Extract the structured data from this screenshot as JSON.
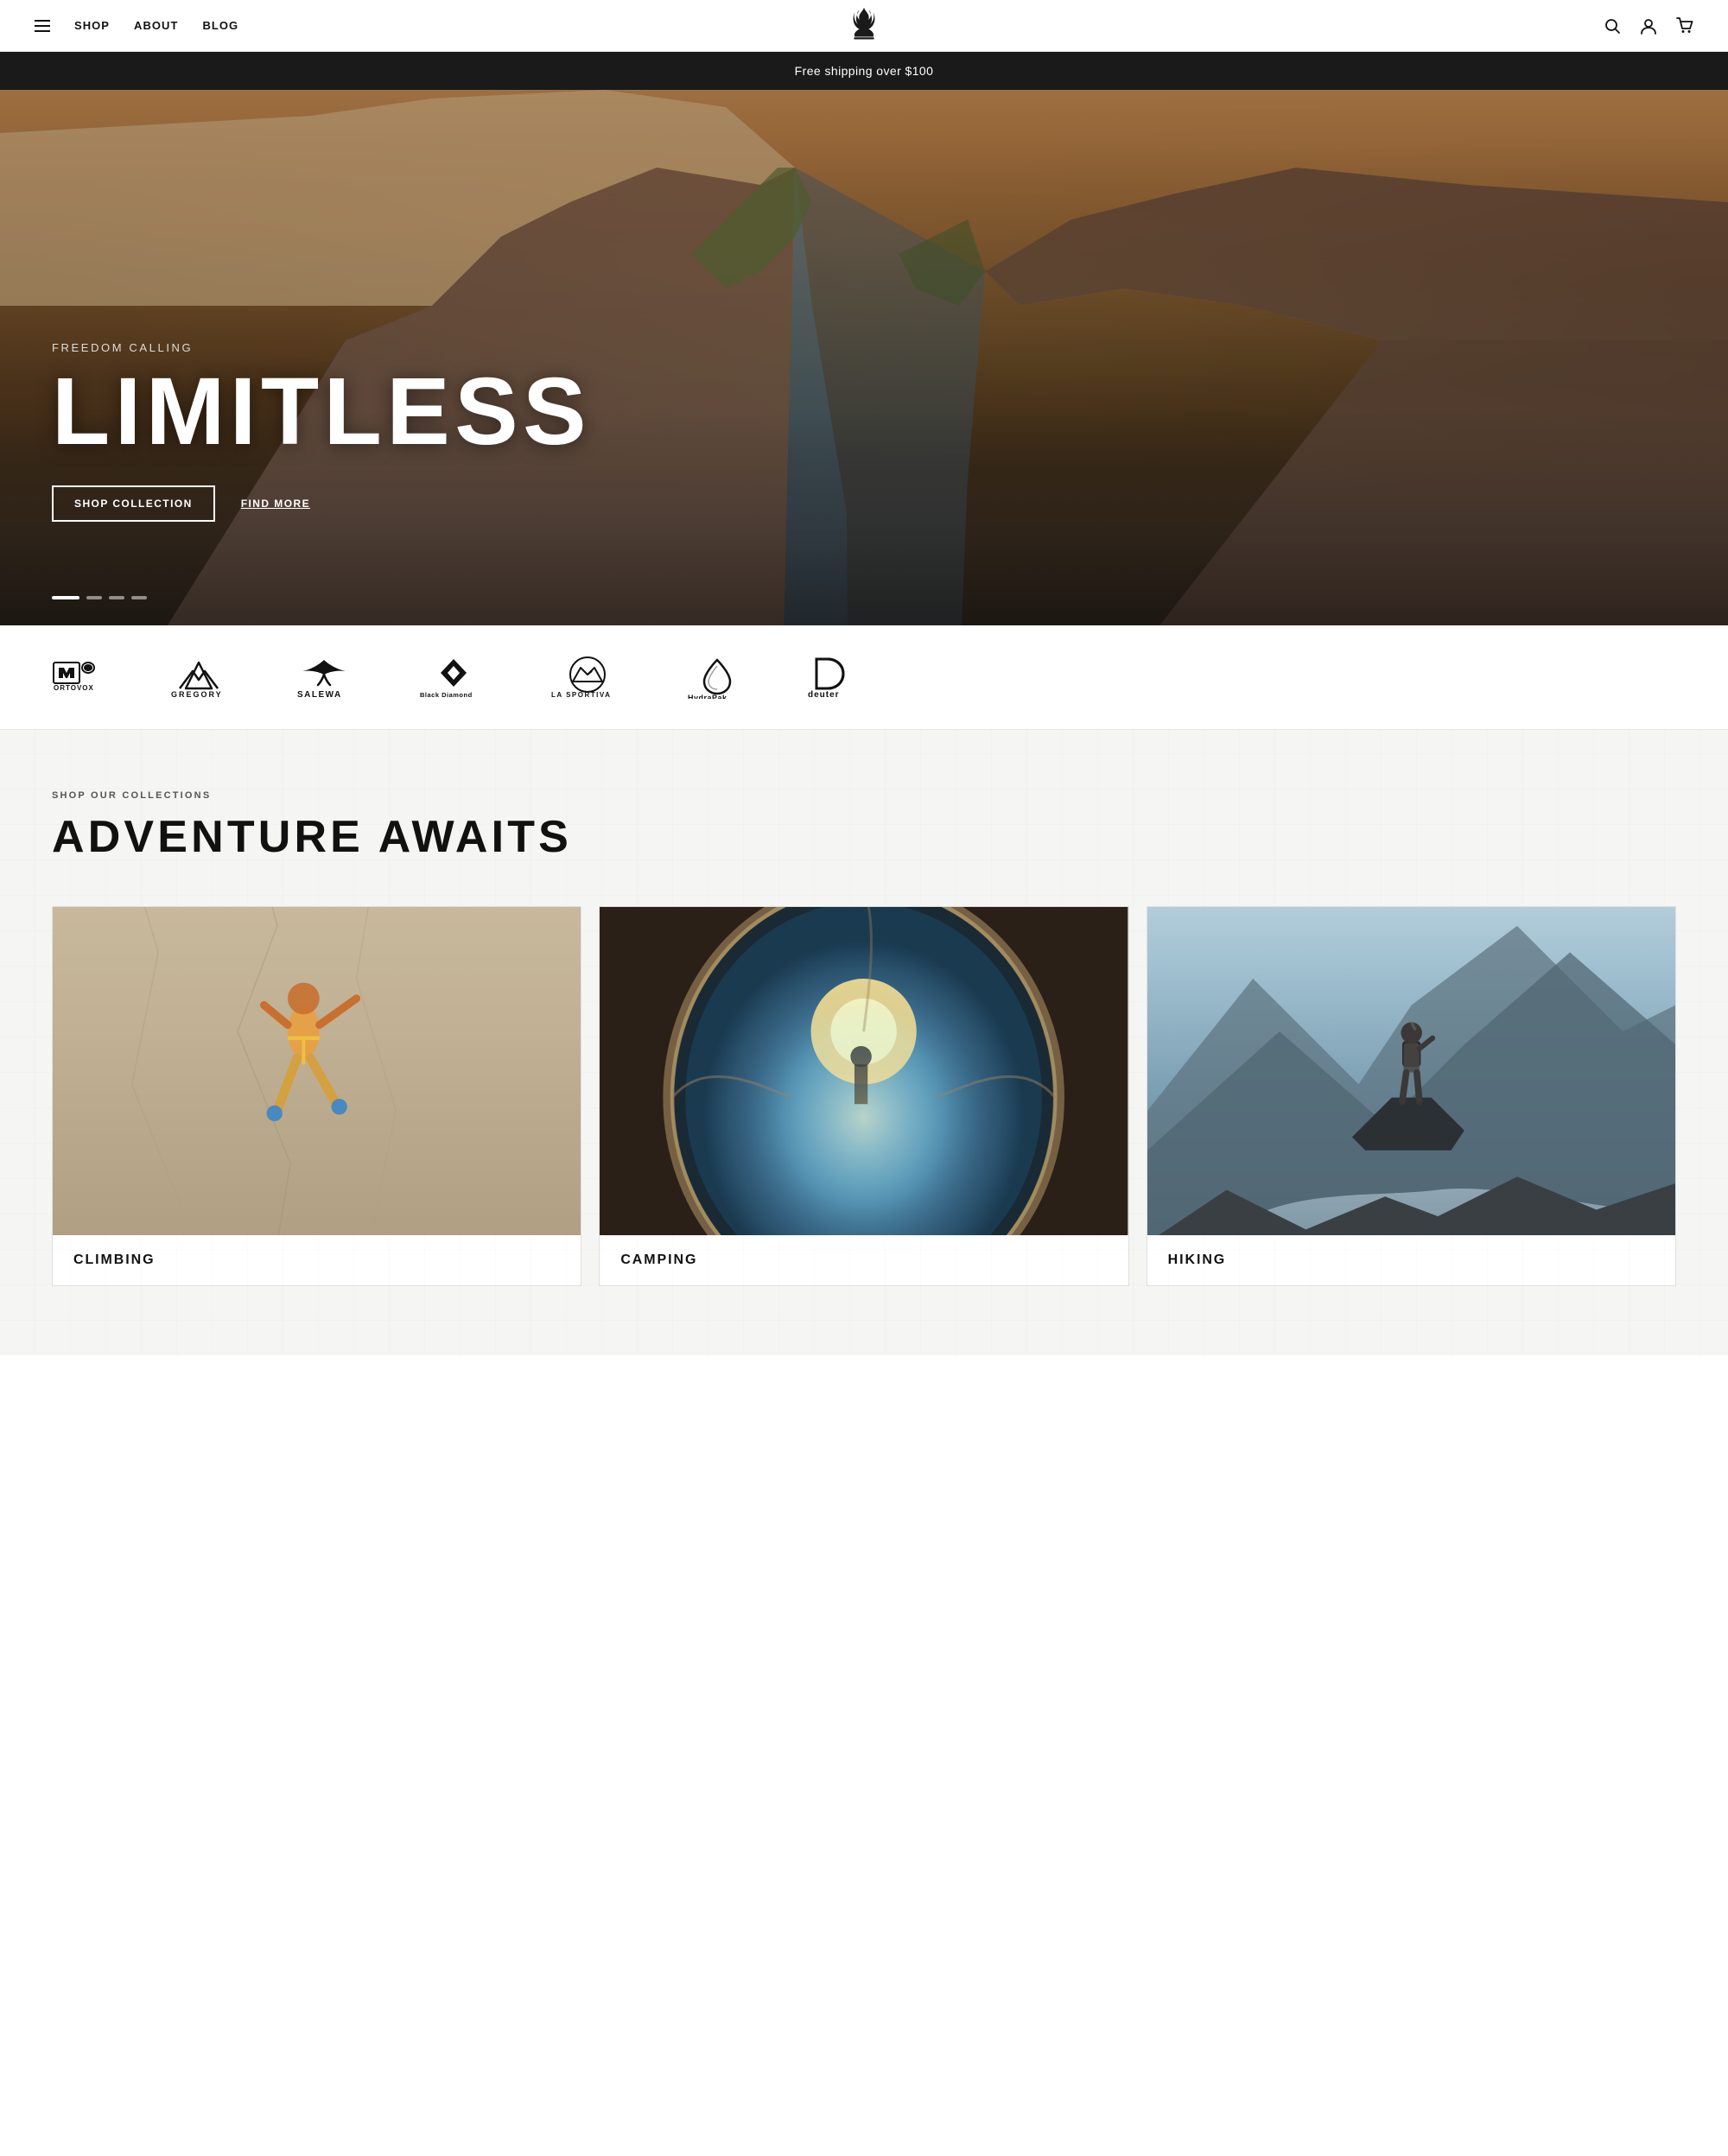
{
  "nav": {
    "shop_label": "SHOP",
    "about_label": "ABOUT",
    "blog_label": "BLOG"
  },
  "banner": {
    "text": "Free shipping over $100"
  },
  "hero": {
    "subtitle": "FREEDOM CALLING",
    "title": "LIMITLESS",
    "btn_shop": "SHOP COLLECTION",
    "btn_find": "FIND MORE",
    "dots": [
      {
        "state": "active"
      },
      {
        "state": "inactive"
      },
      {
        "state": "inactive"
      },
      {
        "state": "inactive"
      }
    ]
  },
  "brands": {
    "items": [
      {
        "name": "ORTOVOX",
        "id": "ortovox"
      },
      {
        "name": "GREGORY",
        "id": "gregory"
      },
      {
        "name": "SALEWA",
        "id": "salewa"
      },
      {
        "name": "Black Diamond",
        "id": "blackdiamond"
      },
      {
        "name": "LA SPORTIVA",
        "id": "lasportiva"
      },
      {
        "name": "HydraPak",
        "id": "hydrapak"
      },
      {
        "name": "deuter",
        "id": "deuter"
      }
    ]
  },
  "collections": {
    "label": "SHOP OUR COLLECTIONS",
    "title": "ADVENTURE AWAITS",
    "items": [
      {
        "name": "CLIMBING",
        "img_type": "climbing"
      },
      {
        "name": "CAMPING",
        "img_type": "camping"
      },
      {
        "name": "HIKING",
        "img_type": "hiking"
      }
    ]
  }
}
